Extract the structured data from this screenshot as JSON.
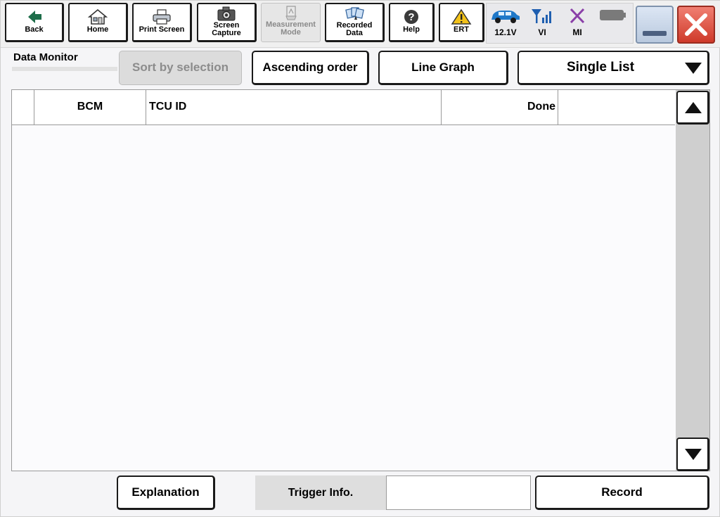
{
  "toolbar": {
    "buttons": [
      {
        "label": "Back",
        "icon": "back-arrow-icon",
        "enabled": true
      },
      {
        "label": "Home",
        "icon": "home-icon",
        "enabled": true
      },
      {
        "label": "Print Screen",
        "icon": "printer-icon",
        "enabled": true
      },
      {
        "label": "Screen\nCapture",
        "icon": "camera-icon",
        "enabled": true
      },
      {
        "label": "Measurement\nMode",
        "icon": "measurement-icon",
        "enabled": false
      },
      {
        "label": "Recorded\nData",
        "icon": "recorded-data-icon",
        "enabled": true
      },
      {
        "label": "Help",
        "icon": "help-icon",
        "enabled": true
      },
      {
        "label": "ERT",
        "icon": "warning-icon",
        "enabled": true
      }
    ],
    "status": {
      "battery_voltage": "12.1V",
      "vi_label": "VI",
      "mi_label": "MI",
      "colors": {
        "car": "#1f78c8",
        "signal": "#1f5fb0",
        "mi_x": "#8a3fa8",
        "battery": "#7a7a7a"
      }
    }
  },
  "header": {
    "title": "Data Monitor",
    "sort_by_selection": "Sort by selection",
    "ascending_order": "Ascending order",
    "line_graph": "Line Graph",
    "view_mode": "Single List"
  },
  "table": {
    "columns": [
      "",
      "BCM",
      "TCU ID",
      "Done",
      ""
    ],
    "rows": []
  },
  "footer": {
    "explanation": "Explanation",
    "trigger_info": "Trigger Info.",
    "trigger_value": "",
    "record": "Record"
  },
  "colors": {
    "close_button": "#d94a3a",
    "minimize_button": "#c3d2e6"
  }
}
